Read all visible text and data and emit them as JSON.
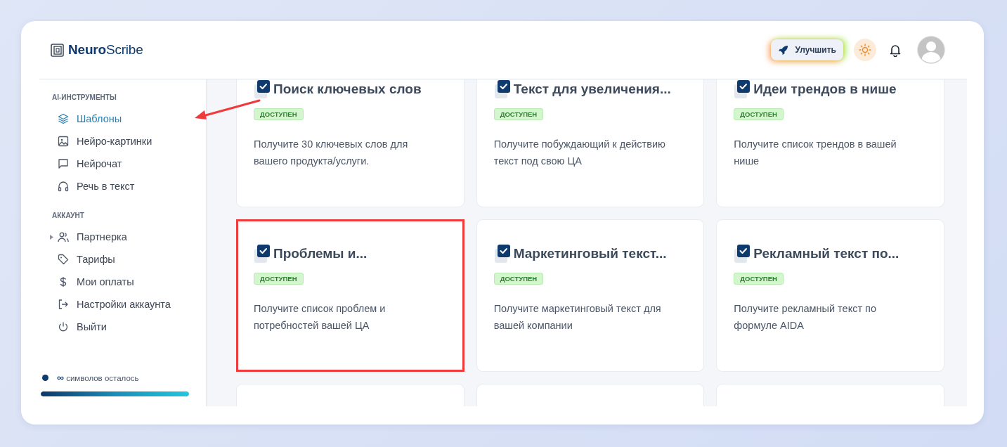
{
  "header": {
    "logo": "**Neuro**Scribe",
    "upgrade_button": "Улучшить"
  },
  "sidebar": {
    "sections": [
      {
        "title": "AI-ИНСТРУМЕНТЫ",
        "items": [
          {
            "label": "Шаблоны",
            "selected": true,
            "expandable": false
          },
          {
            "label": "Нейро-картинки",
            "selected": false,
            "expandable": false
          },
          {
            "label": "Нейрочат",
            "selected": false,
            "expandable": false
          },
          {
            "label": "Речь в текст",
            "selected": false,
            "expandable": false
          }
        ]
      },
      {
        "title": "АККАУНТ",
        "items": [
          {
            "label": "Партнерка",
            "selected": false,
            "expandable": true
          },
          {
            "label": "Тарифы",
            "selected": false,
            "expandable": false
          },
          {
            "label": "Мои оплаты",
            "selected": false,
            "expandable": false
          },
          {
            "label": "Настройки аккаунта",
            "selected": false,
            "expandable": false
          },
          {
            "label": "Выйти",
            "selected": false,
            "expandable": false
          }
        ]
      }
    ],
    "quota": {
      "text": "**∞** символов осталось",
      "color": "#0e3a6e"
    }
  },
  "cards": [
    {
      "title": "Поиск ключевых слов",
      "badge": "ДОСТУПЕН",
      "description": "Получите 30 ключевых слов для вашего продукта/услуги.",
      "highlighted": false
    },
    {
      "title": "Текст для увеличения...",
      "badge": "ДОСТУПЕН",
      "description": "Получите побуждающий к действию текст под свою ЦА",
      "highlighted": false
    },
    {
      "title": "Идеи трендов в нише",
      "badge": "ДОСТУПЕН",
      "description": "Получите список трендов в вашей нише",
      "highlighted": false
    },
    {
      "title": "Проблемы и...",
      "badge": "ДОСТУПЕН",
      "description": "Получите список проблем и потребностей вашей ЦА",
      "highlighted": true
    },
    {
      "title": "Маркетинговый текст...",
      "badge": "ДОСТУПЕН",
      "description": "Получите маркетинговый текст для вашей компании",
      "highlighted": false
    },
    {
      "title": "Рекламный текст по...",
      "badge": "ДОСТУПЕН",
      "description": "Получите рекламный текст по формуле AIDA",
      "highlighted": false
    },
    {
      "highlighted": false
    },
    {
      "highlighted": false
    },
    {
      "highlighted": false
    }
  ],
  "annotations": {
    "arrow_to_selected_item": true
  }
}
